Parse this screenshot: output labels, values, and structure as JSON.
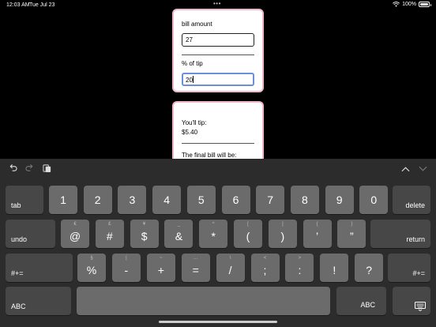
{
  "status": {
    "time": "12:03 AM",
    "date": "Tue Jul 23",
    "battery": "100%"
  },
  "bill_form": {
    "bill_label": "bill amount",
    "bill_value": "27",
    "tip_label": "% of tip",
    "tip_value": "20"
  },
  "result": {
    "tip_label": "You'll tip:",
    "tip_amount": "$5.40",
    "final_label": "The final bill will be:"
  },
  "keyboard": {
    "row1": [
      {
        "main": "1"
      },
      {
        "main": "2"
      },
      {
        "main": "3"
      },
      {
        "main": "4"
      },
      {
        "main": "5"
      },
      {
        "main": "6"
      },
      {
        "main": "7"
      },
      {
        "main": "8"
      },
      {
        "main": "9"
      },
      {
        "main": "0"
      }
    ],
    "row2": [
      {
        "main": "@",
        "hint": "€"
      },
      {
        "main": "#",
        "hint": "£"
      },
      {
        "main": "$",
        "hint": "¥"
      },
      {
        "main": "&",
        "hint": "_"
      },
      {
        "main": "*",
        "hint": "^"
      },
      {
        "main": "(",
        "hint": "["
      },
      {
        "main": ")",
        "hint": "]"
      },
      {
        "main": "’",
        "hint": "{"
      },
      {
        "main": "”",
        "hint": "}"
      }
    ],
    "row3": [
      {
        "main": "%",
        "hint": "§"
      },
      {
        "main": "-",
        "hint": "|"
      },
      {
        "main": "+",
        "hint": "~"
      },
      {
        "main": "=",
        "hint": "…"
      },
      {
        "main": "/",
        "hint": "\\"
      },
      {
        "main": ";",
        "hint": "<"
      },
      {
        "main": ":",
        "hint": ">"
      },
      {
        "main": "!",
        "hint": ""
      },
      {
        "main": "?",
        "hint": ""
      }
    ],
    "tab": "tab",
    "delete": "delete",
    "undo": "undo",
    "return": "return",
    "symbols_left": "#+=",
    "symbols_right": "#+=",
    "abc_left": "ABC",
    "abc_right": "ABC",
    "undo_icon": "undo-arrow-icon",
    "redo_icon": "redo-arrow-icon",
    "paste_icon": "paste-icon",
    "chevron_up_icon": "chevron-up-icon",
    "chevron_down_icon": "chevron-down-icon",
    "dismiss_icon": "keyboard-dismiss-icon"
  }
}
